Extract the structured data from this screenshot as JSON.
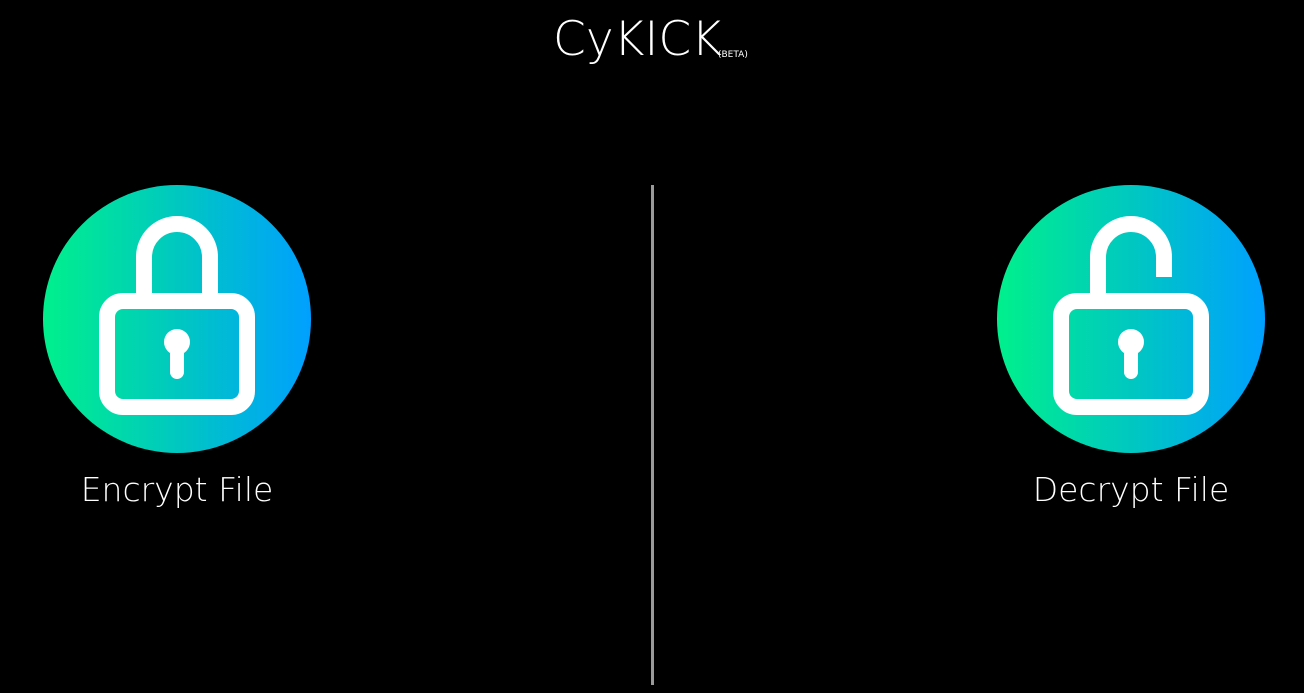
{
  "app": {
    "title": "CyKICK",
    "badge": "(BETA)"
  },
  "actions": [
    {
      "label": "Encrypt File",
      "icon": "locked-padlock-icon"
    },
    {
      "label": "Decrypt File",
      "icon": "unlocked-padlock-icon"
    }
  ],
  "colors": {
    "background": "#000000",
    "text": "#ffffff",
    "gradient_start": "#00f08c",
    "gradient_end": "#00a0ff",
    "divider": "#9a9a9a"
  }
}
